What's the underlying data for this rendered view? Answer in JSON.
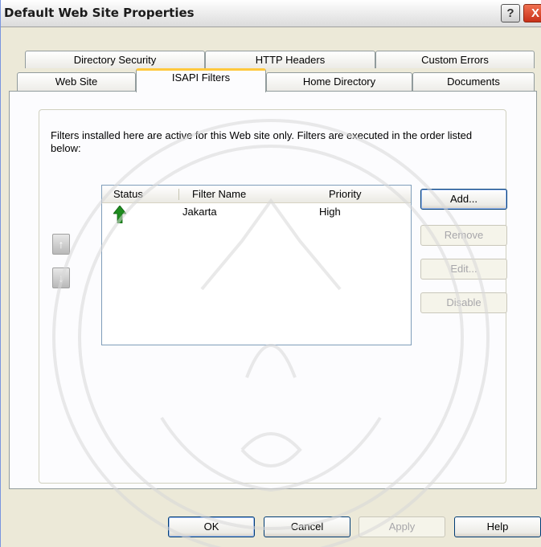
{
  "window": {
    "title": "Default Web Site Properties",
    "help_label": "?",
    "close_label": "X"
  },
  "tabs": {
    "row1": [
      "Directory Security",
      "HTTP Headers",
      "Custom Errors"
    ],
    "row2": [
      "Web Site",
      "ISAPI Filters",
      "Home Directory",
      "Documents"
    ],
    "active": "ISAPI Filters"
  },
  "panel": {
    "description": "Filters installed here are active for this Web site only. Filters are executed in the order listed below:"
  },
  "list": {
    "columns": [
      "Status",
      "Filter Name",
      "Priority"
    ],
    "rows": [
      {
        "status_icon": "green-up-arrow-icon",
        "name": "Jakarta",
        "priority": "High"
      }
    ]
  },
  "side_buttons": {
    "add": "Add...",
    "remove": "Remove",
    "edit": "Edit...",
    "disable": "Disable"
  },
  "order_buttons": {
    "up": "↑",
    "down": "↓"
  },
  "footer": {
    "ok": "OK",
    "cancel": "Cancel",
    "apply": "Apply",
    "help": "Help"
  },
  "colors": {
    "dialog_bg": "#ece9d8",
    "panel_bg": "#fcfcfe",
    "active_tab_accent": "#ffc83c",
    "status_arrow": "#1e8c1e",
    "button_border": "#003c74"
  }
}
